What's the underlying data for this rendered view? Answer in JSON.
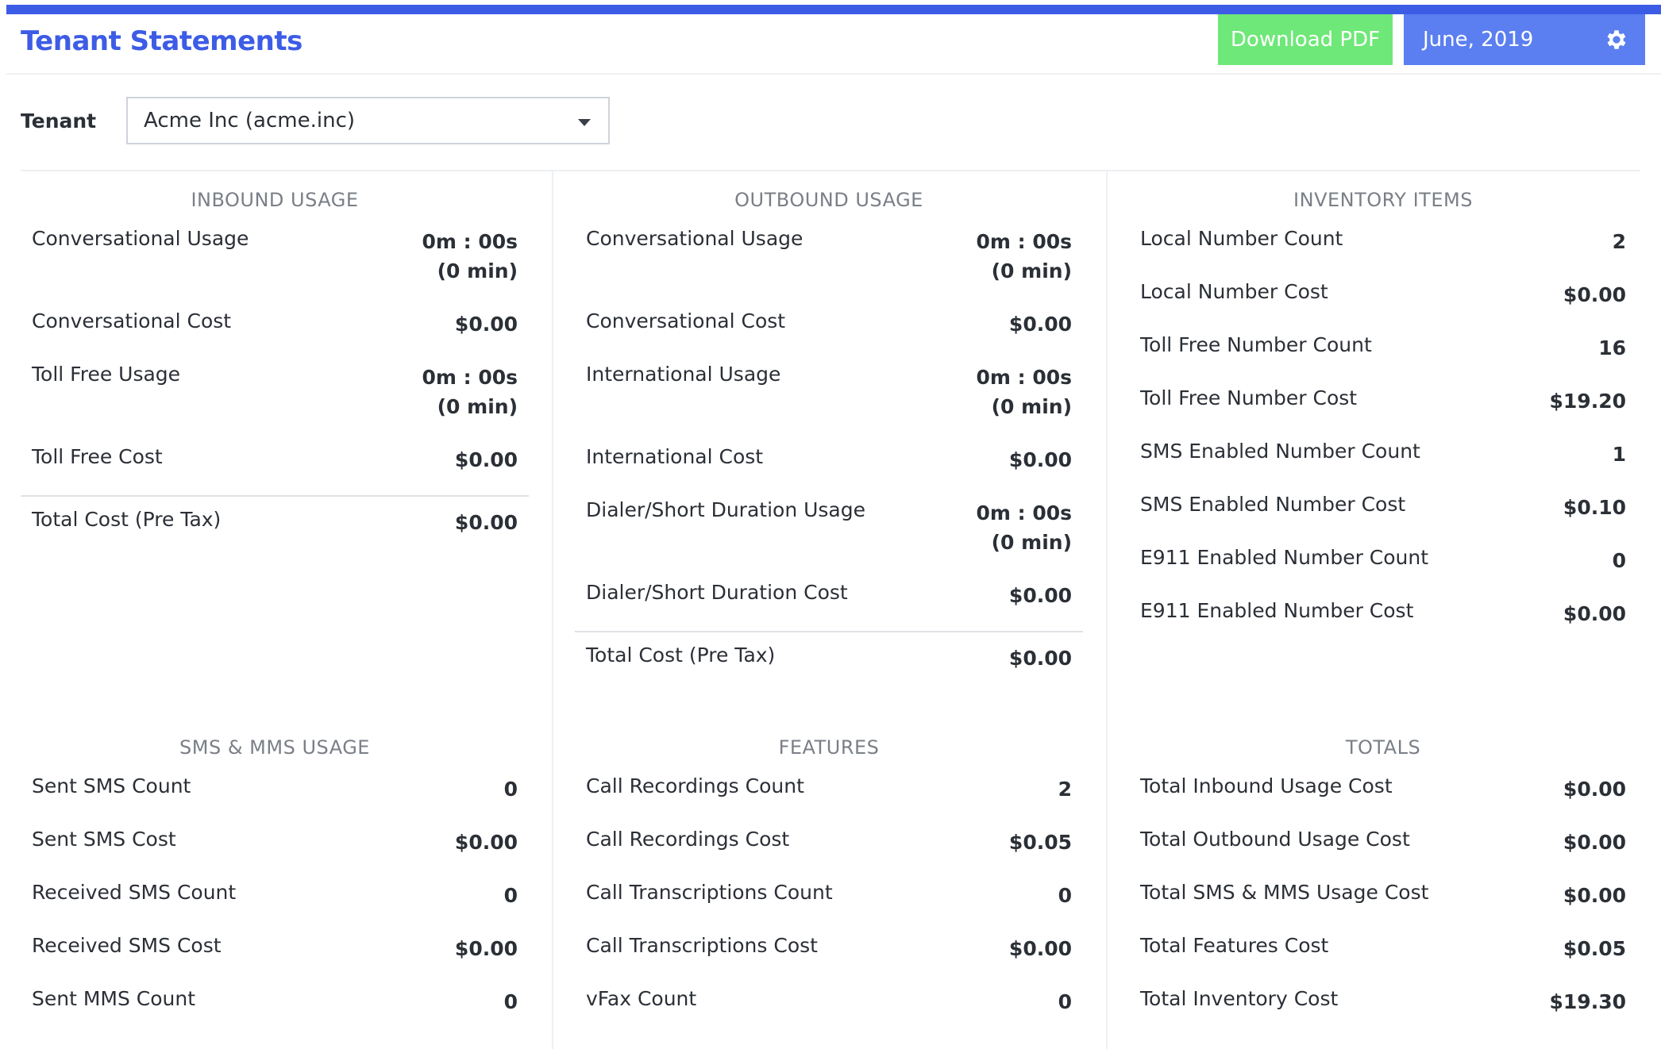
{
  "header": {
    "title": "Tenant Statements",
    "download_label": "Download PDF",
    "period_label": "June, 2019"
  },
  "tenant": {
    "label": "Tenant",
    "selected": "Acme Inc (acme.inc)"
  },
  "colors": {
    "accent": "#3d5ce6",
    "download": "#6ee878",
    "period": "#5b7ff0"
  },
  "icons": {
    "period": "gear-icon",
    "select": "chevron-down-icon"
  },
  "inbound": {
    "title": "INBOUND USAGE",
    "rows": [
      {
        "label": "Conversational Usage",
        "value": "0m : 00s",
        "value2": "(0 min)"
      },
      {
        "label": "Conversational Cost",
        "value": "$0.00"
      },
      {
        "label": "Toll Free Usage",
        "value": "0m : 00s",
        "value2": "(0 min)"
      },
      {
        "label": "Toll Free Cost",
        "value": "$0.00"
      }
    ],
    "total": {
      "label": "Total Cost (Pre Tax)",
      "value": "$0.00"
    }
  },
  "outbound": {
    "title": "OUTBOUND USAGE",
    "rows": [
      {
        "label": "Conversational Usage",
        "value": "0m : 00s",
        "value2": "(0 min)"
      },
      {
        "label": "Conversational Cost",
        "value": "$0.00"
      },
      {
        "label": "International Usage",
        "value": "0m : 00s",
        "value2": "(0 min)"
      },
      {
        "label": "International Cost",
        "value": "$0.00"
      },
      {
        "label": "Dialer/Short Duration Usage",
        "value": "0m : 00s",
        "value2": "(0 min)"
      },
      {
        "label": "Dialer/Short Duration Cost",
        "value": "$0.00"
      }
    ],
    "total": {
      "label": "Total Cost (Pre Tax)",
      "value": "$0.00"
    }
  },
  "inventory": {
    "title": "INVENTORY ITEMS",
    "rows": [
      {
        "label": "Local Number Count",
        "value": "2"
      },
      {
        "label": "Local Number Cost",
        "value": "$0.00"
      },
      {
        "label": "Toll Free Number Count",
        "value": "16"
      },
      {
        "label": "Toll Free Number Cost",
        "value": "$19.20"
      },
      {
        "label": "SMS Enabled Number Count",
        "value": "1"
      },
      {
        "label": "SMS Enabled Number Cost",
        "value": "$0.10"
      },
      {
        "label": "E911 Enabled Number Count",
        "value": "0"
      },
      {
        "label": "E911 Enabled Number Cost",
        "value": "$0.00"
      }
    ]
  },
  "sms": {
    "title": "SMS & MMS USAGE",
    "rows": [
      {
        "label": "Sent SMS Count",
        "value": "0"
      },
      {
        "label": "Sent SMS Cost",
        "value": "$0.00"
      },
      {
        "label": "Received SMS Count",
        "value": "0"
      },
      {
        "label": "Received SMS Cost",
        "value": "$0.00"
      },
      {
        "label": "Sent MMS Count",
        "value": "0"
      }
    ]
  },
  "features": {
    "title": "FEATURES",
    "rows": [
      {
        "label": "Call Recordings Count",
        "value": "2"
      },
      {
        "label": "Call Recordings Cost",
        "value": "$0.05"
      },
      {
        "label": "Call Transcriptions Count",
        "value": "0"
      },
      {
        "label": "Call Transcriptions Cost",
        "value": "$0.00"
      },
      {
        "label": "vFax Count",
        "value": "0"
      }
    ]
  },
  "totals": {
    "title": "TOTALS",
    "rows": [
      {
        "label": "Total Inbound Usage Cost",
        "value": "$0.00"
      },
      {
        "label": "Total Outbound Usage Cost",
        "value": "$0.00"
      },
      {
        "label": "Total SMS & MMS Usage Cost",
        "value": "$0.00"
      },
      {
        "label": "Total Features Cost",
        "value": "$0.05"
      },
      {
        "label": "Total Inventory Cost",
        "value": "$19.30"
      }
    ]
  }
}
